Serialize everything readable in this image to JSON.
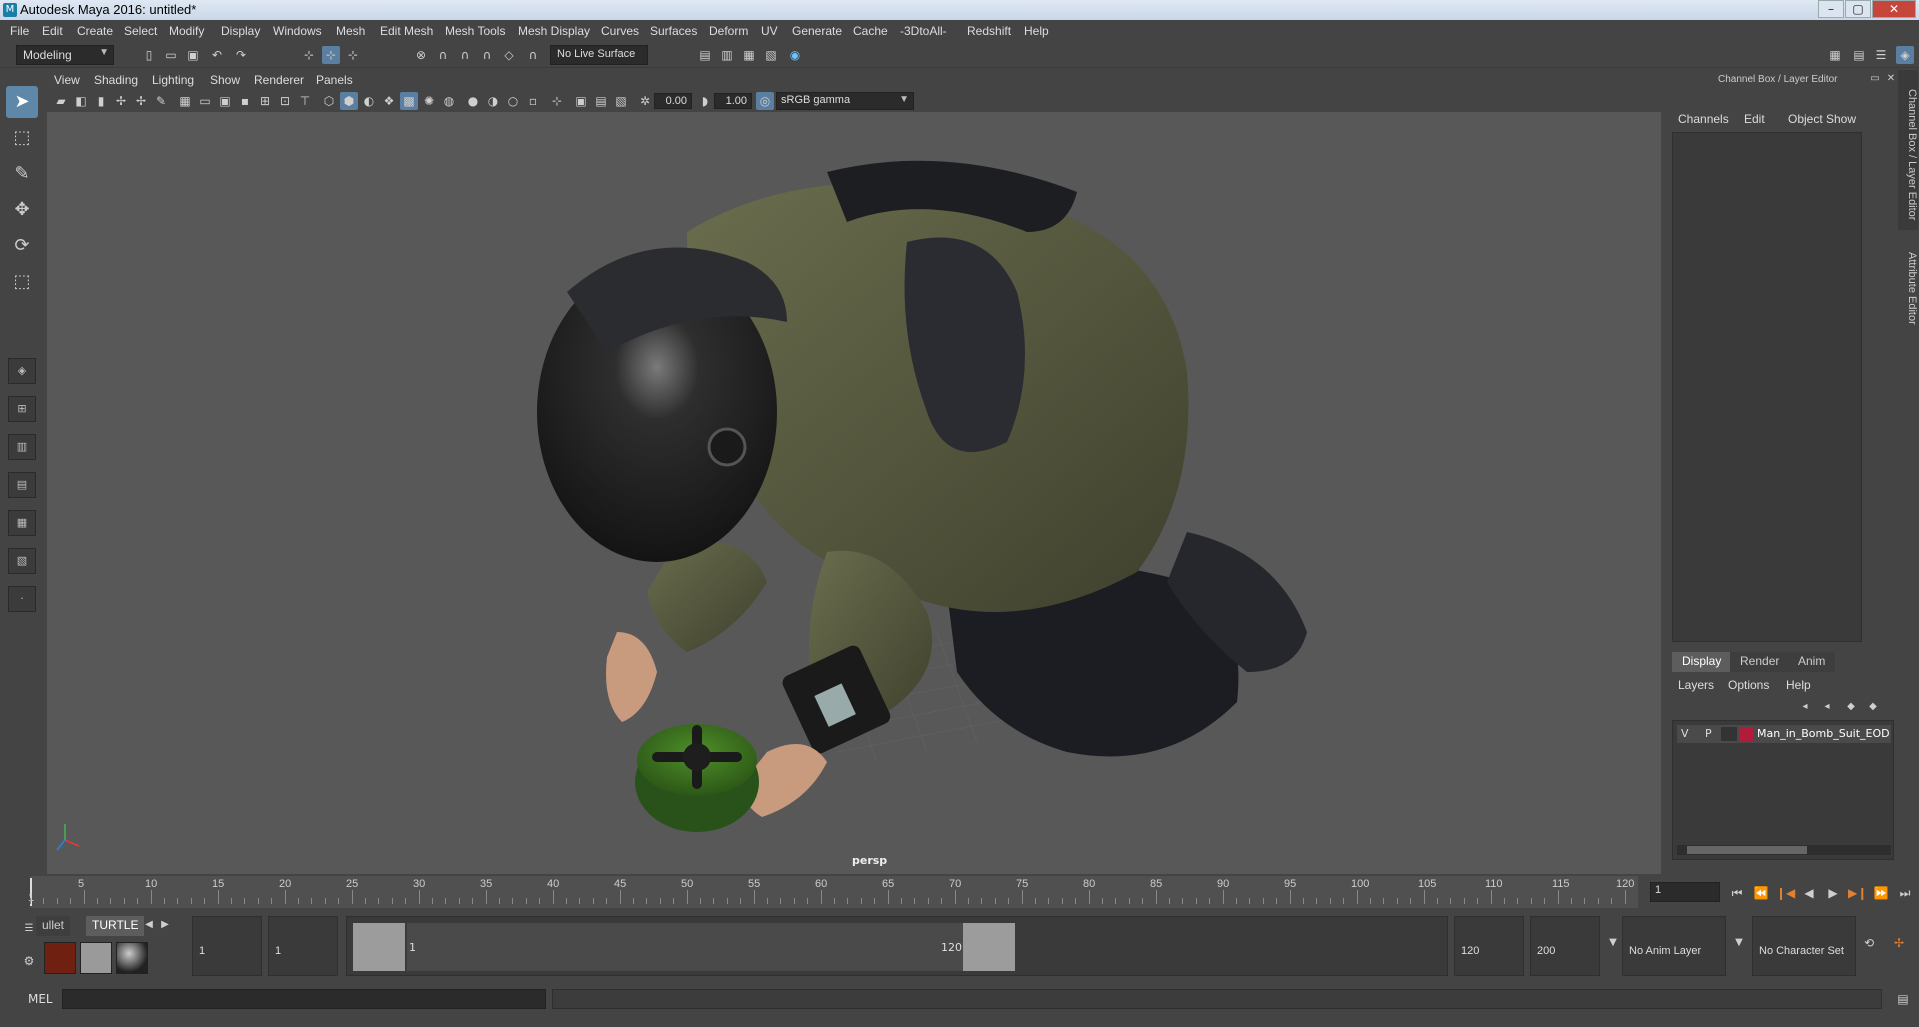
{
  "window": {
    "title": "Autodesk Maya 2016: untitled*",
    "min": "–",
    "max": "▢",
    "close": "✕"
  },
  "menubar": [
    "File",
    "Edit",
    "Create",
    "Select",
    "Modify",
    "Display",
    "Windows",
    "Mesh",
    "Edit Mesh",
    "Mesh Tools",
    "Mesh Display",
    "Curves",
    "Surfaces",
    "Deform",
    "UV",
    "Generate",
    "Cache",
    "-3DtoAll-",
    "Redshift",
    "Help"
  ],
  "status_line": {
    "mode": "Modeling",
    "live_surface": "No Live Surface"
  },
  "viewport_menu": [
    "View",
    "Shading",
    "Lighting",
    "Show",
    "Renderer",
    "Panels"
  ],
  "viewport_toolbar": {
    "exposure": "0.00",
    "gamma": "1.00",
    "color_space": "sRGB gamma"
  },
  "viewport": {
    "camera": "persp",
    "bg_color": "#585858"
  },
  "right_panel": {
    "title": "Channel Box / Layer Editor",
    "channel_menu": [
      "Channels",
      "Edit",
      "Object",
      "Show"
    ],
    "side_tabs": [
      "Channel Box / Layer Editor",
      "Attribute Editor"
    ],
    "layer_tabs": [
      "Display",
      "Render",
      "Anim"
    ],
    "layer_menu": [
      "Layers",
      "Options",
      "Help"
    ],
    "layer": {
      "v": "V",
      "p": "P",
      "name": "Man_in_Bomb_Suit_EOD",
      "color": "#b01c3a"
    }
  },
  "time_slider": {
    "ticks": [
      "5",
      "10",
      "15",
      "20",
      "25",
      "30",
      "35",
      "40",
      "45",
      "50",
      "55",
      "60",
      "65",
      "70",
      "75",
      "80",
      "85",
      "90",
      "95",
      "100",
      "105",
      "110",
      "115",
      "120"
    ],
    "start_label": "1",
    "current_frame": "1"
  },
  "range_slider": {
    "shelf_tabs": [
      "ullet",
      "TURTLE"
    ],
    "start": "1",
    "playback_start": "1",
    "range_start_label": "1",
    "range_end_label": "120",
    "playback_end": "120",
    "end": "200",
    "anim_layer": "No Anim Layer",
    "char_set": "No Character Set"
  },
  "command_line": {
    "label": "MEL"
  }
}
